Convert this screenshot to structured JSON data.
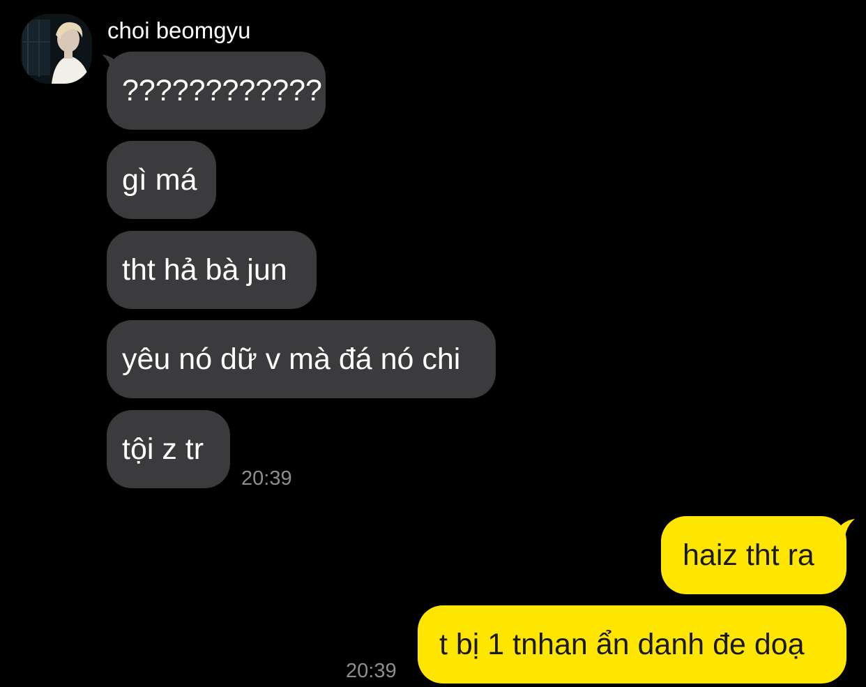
{
  "chat": {
    "contact": {
      "name": "choi beomgyu",
      "avatar_icon": "profile-photo"
    },
    "incoming": [
      {
        "text": "????????????"
      },
      {
        "text": "gì má"
      },
      {
        "text": "tht hả bà jun"
      },
      {
        "text": "yêu nó dữ v mà đá nó chi"
      },
      {
        "text": "tội z tr"
      }
    ],
    "incoming_time": "20:39",
    "outgoing": [
      {
        "text": "haiz tht ra"
      },
      {
        "text": "t bị 1 tnhan ẩn danh đe doạ"
      }
    ],
    "outgoing_time": "20:39"
  },
  "colors": {
    "background": "#000000",
    "incoming_bubble": "#3b3b3d",
    "outgoing_bubble": "#ffe600",
    "timestamp": "#8e8e8e"
  }
}
